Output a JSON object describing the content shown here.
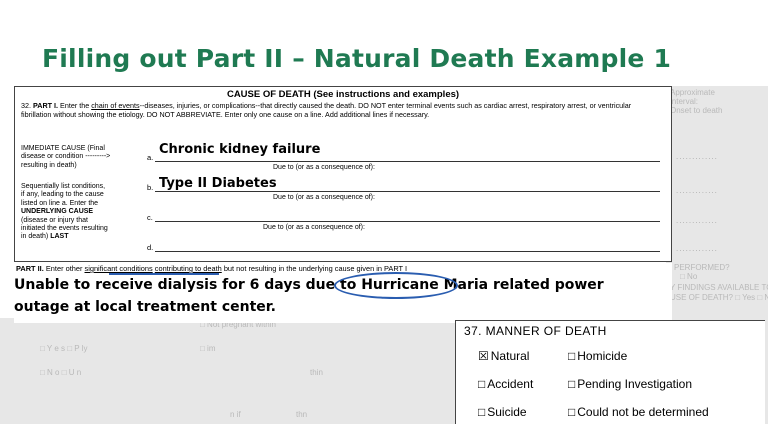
{
  "slide": {
    "title": "Filling out Part II – Natural Death Example 1"
  },
  "form": {
    "heading": "CAUSE OF DEATH (See instructions and examples)",
    "part1_num": "32.",
    "part1_label": "PART I.",
    "part1_text_a": "Enter the",
    "part1_chain": "chain of events",
    "part1_text_b": "--diseases, injuries, or complications--that directly caused the death.  DO NOT enter terminal events such as cardiac arrest, respiratory arrest, or ventricular fibrillation without showing the etiology.  DO NOT ABBREVIATE.  Enter only one cause on a line.  Add additional lines if necessary.",
    "immediate_cause": [
      "IMMEDIATE CAUSE (Final",
      "disease  or condition --------->",
      "resulting  in death)"
    ],
    "sequential": [
      "Sequentially list conditions,",
      "if any,  leading to the cause",
      "listed on line a.  Enter the"
    ],
    "underlying_label": "UNDERLYING CAUSE",
    "underlying_detail": [
      "(disease or injury that",
      "initiated the  events resulting"
    ],
    "in_death": "in death)",
    "last": "LAST",
    "letters": [
      "a.",
      "b.",
      "c.",
      "d."
    ],
    "due_to": "Due to (or as a consequence of):",
    "cause_a": "Chronic kidney failure",
    "cause_b": "Type II Diabetes"
  },
  "faded": {
    "approximate": "Approximate",
    "interval": "interval:",
    "onset": "Onset to death",
    "dots": ".............",
    "performed": "PERFORMED?",
    "no": "□ No",
    "findings": "Y FINDINGS AVAILABLE TO",
    "cause_of_death": "USE OF DEATH?  □ Yes □ No",
    "not_pregnant": "□ Not pregnant within",
    "yes_p": "□  Y e s □   P       ly",
    "no_u": "□   N o  □   U       n",
    "row_im": "□         im",
    "row_thin": "thin",
    "row_nif": "n if",
    "row_thn2": "thn"
  },
  "part2": {
    "label": "PART II.",
    "instr_a": "Enter other",
    "instr_sig": "significant conditions",
    "instr_contrib": "contributing to death",
    "instr_b": "but not resulting in the underlying cause given in PART I",
    "line1_pre": "Unable to receive dialysis for 6 days due to ",
    "line1_hl": "Hurricane Maria",
    "line1_post": " related power",
    "line2": "outage at local treatment center."
  },
  "manner": {
    "title": "37.  MANNER OF DEATH",
    "options": [
      {
        "label": "Natural",
        "checked": true
      },
      {
        "label": "Homicide",
        "checked": false
      },
      {
        "label": "Accident",
        "checked": false
      },
      {
        "label": "Pending Investigation",
        "checked": false
      },
      {
        "label": "Suicide",
        "checked": false
      },
      {
        "label": "Could not be determined",
        "checked": false
      }
    ],
    "checked_mark": "☒",
    "unchecked_mark": "□",
    "accent": "#2a5db0"
  }
}
